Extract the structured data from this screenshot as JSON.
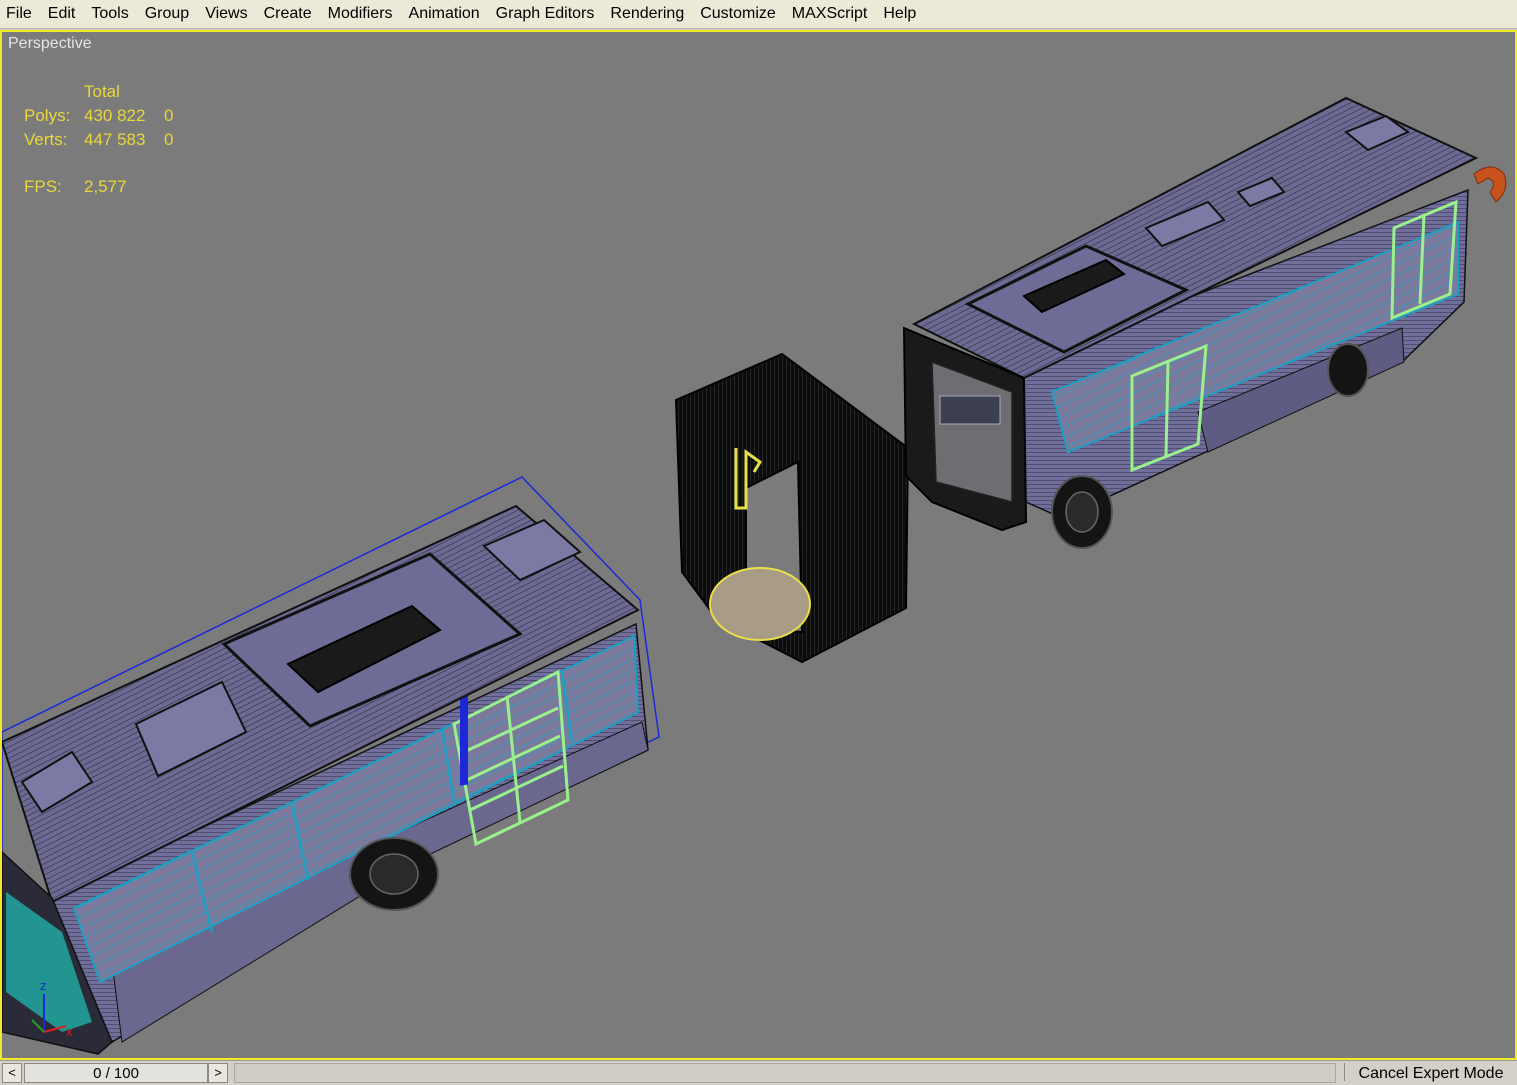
{
  "menu": [
    "File",
    "Edit",
    "Tools",
    "Group",
    "Views",
    "Create",
    "Modifiers",
    "Animation",
    "Graph Editors",
    "Rendering",
    "Customize",
    "MAXScript",
    "Help"
  ],
  "viewport": {
    "label": "Perspective",
    "stats": {
      "header": "Total",
      "polys_label": "Polys:",
      "polys_total": "430 822",
      "polys_selected": "0",
      "verts_label": "Verts:",
      "verts_total": "447 583",
      "verts_selected": "0",
      "fps_label": "FPS:",
      "fps_value": "2,577"
    },
    "axes": {
      "z": "z",
      "x": "x"
    }
  },
  "statusbar": {
    "prev_icon": "<",
    "time_display": "0 / 100",
    "next_icon": ">",
    "expert_button": "Cancel Expert Mode"
  },
  "colors": {
    "viewport_bg": "#7b7b7b",
    "active_border": "#f2ea28",
    "stats_text": "#e8d83a",
    "bus_body": "#706e9a",
    "bus_roof": "#6c6a92",
    "glass_cyan": "#2aa6c0",
    "door_green": "#9af08c",
    "selection_blue": "#1c28d8"
  }
}
